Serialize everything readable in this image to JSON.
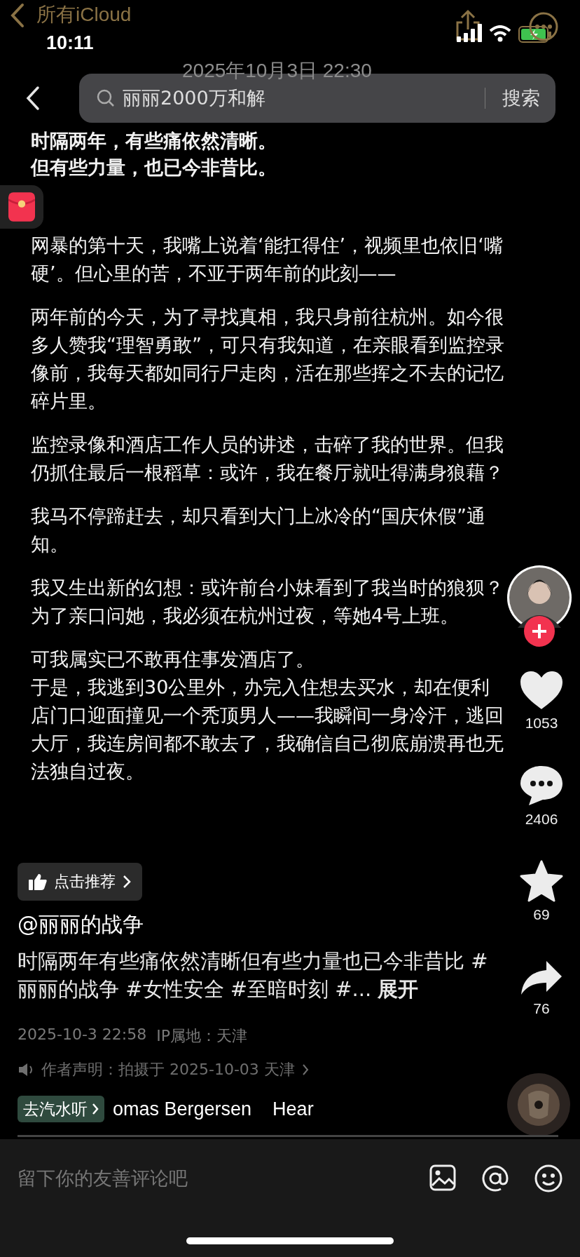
{
  "status_bar": {
    "back_label": "所有iCloud",
    "time": "10:11"
  },
  "date": "2025年10月3日 22:30",
  "search": {
    "value": "丽丽2000万和解",
    "button": "搜索"
  },
  "paragraphs": [
    {
      "bold": true,
      "lines": [
        "时隔两年，有些痛依然清晰。",
        "但有些力量，也已今非昔比。"
      ]
    },
    {
      "bold": false,
      "lines": [
        "网暴的第十天，我嘴上说着‘能扛得住’，视频里也依旧‘嘴硬’。但心里的苦，不亚于两年前的此刻——"
      ]
    },
    {
      "bold": false,
      "lines": [
        "两年前的今天，为了寻找真相，我只身前往杭州。如今很多人赞我“理智勇敢”，可只有我知道，在亲眼看到监控录像前，我每天都如同行尸走肉，活在那些挥之不去的记忆碎片里。"
      ]
    },
    {
      "bold": false,
      "lines": [
        "监控录像和酒店工作人员的讲述，击碎了我的世界。但我仍抓住最后一根稻草：或许，我在餐厅就吐得满身狼藉？"
      ]
    },
    {
      "bold": false,
      "lines": [
        "我马不停蹄赶去，却只看到大门上冰冷的“国庆休假”通知。"
      ]
    },
    {
      "bold": false,
      "lines": [
        "我又生出新的幻想：或许前台小妹看到了我当时的狼狈？为了亲口问她，我必须在杭州过夜，等她4号上班。"
      ]
    },
    {
      "bold": false,
      "lines": [
        "可我属实已不敢再住事发酒店了。",
        "于是，我逃到30公里外，办完入住想去买水，却在便利店门口迎面撞见一个秃顶男人——我瞬间一身冷汗，逃回大厅，我连房间都不敢去了，我确信自己彻底崩溃再也无法独自过夜。"
      ]
    }
  ],
  "actions": [
    {
      "kind": "like",
      "count": "1053"
    },
    {
      "kind": "comment",
      "count": "2406"
    },
    {
      "kind": "favorite",
      "count": "69"
    },
    {
      "kind": "share",
      "count": "76"
    }
  ],
  "recommend": "点击推荐",
  "author": "@丽丽的战争",
  "description": "时隔两年有些痛依然清晰但有些力量也已今非昔比 #丽丽的战争 #女性安全 #至暗时刻 #...",
  "expand": "展开",
  "posted": "2025-10-3 22:58",
  "location": "IP属地：天津",
  "statement": "作者声明：拍摄于 2025-10-03 天津",
  "music": {
    "chip": "去汽水听",
    "title": "omas Bergersen    Hear"
  },
  "comment_placeholder": "留下你的友善评论吧"
}
